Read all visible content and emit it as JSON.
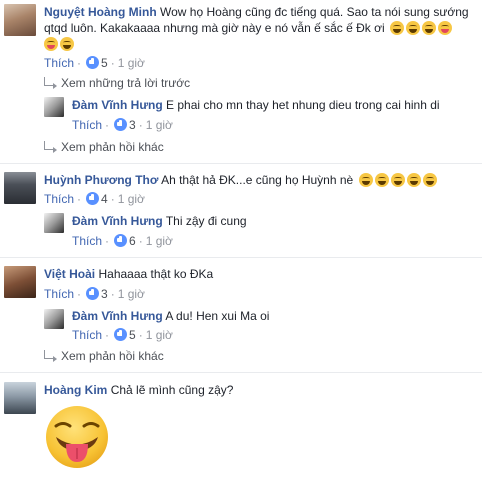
{
  "comments": [
    {
      "author": "Nguyệt Hoàng Minh",
      "text_line1": "Wow họ Hoàng cũng đc tiếng quá. Sao ta nói sung sướng",
      "text_line2": "qtqd luôn. Kakakaaaa nhưng mà giờ này e nó vẫn ế sắc ế Đk ơi",
      "like_label": "Thích",
      "like_count": "5",
      "time": "1 giờ",
      "view_previous": "Xem những trả lời trước",
      "replies": [
        {
          "author": "Đàm Vĩnh Hưng",
          "text": "E phai cho mn thay het nhung dieu trong cai hinh di",
          "like_label": "Thích",
          "like_count": "3",
          "time": "1 giờ"
        }
      ],
      "more_replies": "Xem phản hồi khác"
    },
    {
      "author": "Huỳnh Phương Thơ",
      "text": "Ah thật hả ĐK...e cũng họ Huỳnh nè",
      "like_label": "Thích",
      "like_count": "4",
      "time": "1 giờ",
      "replies": [
        {
          "author": "Đàm Vĩnh Hưng",
          "text": "Thi zậy đi cung",
          "like_label": "Thích",
          "like_count": "6",
          "time": "1 giờ"
        }
      ]
    },
    {
      "author": "Việt Hoài",
      "text": "Hahaaaa thật ko ĐKa",
      "like_label": "Thích",
      "like_count": "3",
      "time": "1 giờ",
      "replies": [
        {
          "author": "Đàm Vĩnh Hưng",
          "text": "A du! Hen xui Ma oi",
          "like_label": "Thích",
          "like_count": "5",
          "time": "1 giờ"
        }
      ],
      "more_replies": "Xem phản hồi khác"
    },
    {
      "author": "Hoàng Kim",
      "text": "Chả lẽ mình cũng zậy?"
    }
  ],
  "colors": {
    "name": "#365899",
    "link": "#4267b2",
    "meta": "#90949c",
    "text": "#1d2129",
    "like_badge": "#5890ff",
    "emoji": "#f7c744"
  }
}
